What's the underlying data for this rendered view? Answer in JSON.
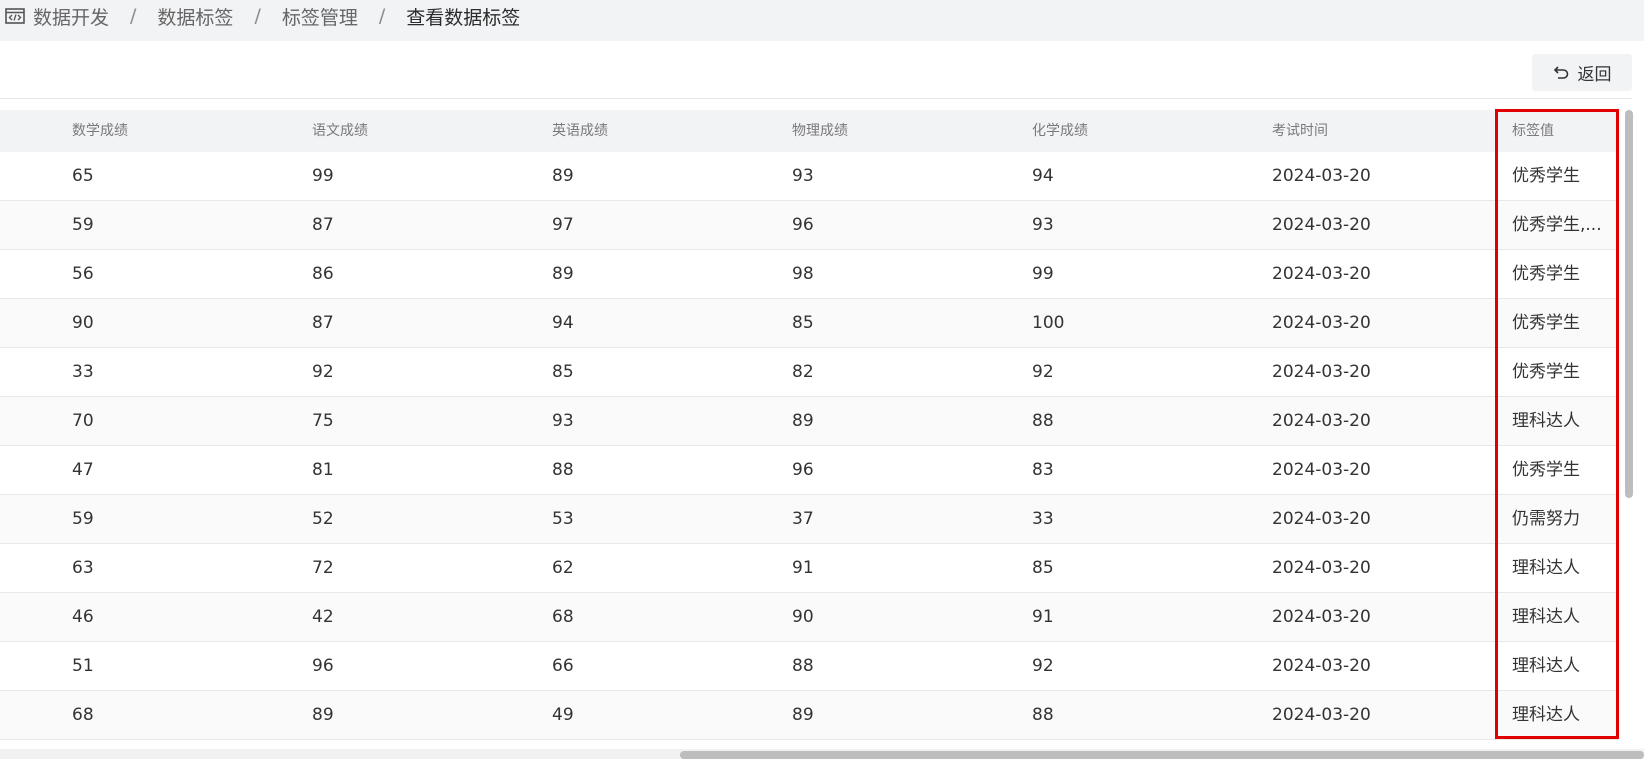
{
  "breadcrumb": {
    "icon": "code-window-icon",
    "items": [
      "数据开发",
      "数据标签",
      "标签管理",
      "查看数据标签"
    ],
    "separator": "/"
  },
  "toolbar": {
    "back_label": "返回",
    "back_icon": "undo-arrow-icon"
  },
  "table": {
    "columns": [
      "数学成绩",
      "语文成绩",
      "英语成绩",
      "物理成绩",
      "化学成绩",
      "考试时间",
      "标签值"
    ],
    "rows": [
      [
        "65",
        "99",
        "89",
        "93",
        "94",
        "2024-03-20",
        "优秀学生"
      ],
      [
        "59",
        "87",
        "97",
        "96",
        "93",
        "2024-03-20",
        "优秀学生,..."
      ],
      [
        "56",
        "86",
        "89",
        "98",
        "99",
        "2024-03-20",
        "优秀学生"
      ],
      [
        "90",
        "87",
        "94",
        "85",
        "100",
        "2024-03-20",
        "优秀学生"
      ],
      [
        "33",
        "92",
        "85",
        "82",
        "92",
        "2024-03-20",
        "优秀学生"
      ],
      [
        "70",
        "75",
        "93",
        "89",
        "88",
        "2024-03-20",
        "理科达人"
      ],
      [
        "47",
        "81",
        "88",
        "96",
        "83",
        "2024-03-20",
        "优秀学生"
      ],
      [
        "59",
        "52",
        "53",
        "37",
        "33",
        "2024-03-20",
        "仍需努力"
      ],
      [
        "63",
        "72",
        "62",
        "91",
        "85",
        "2024-03-20",
        "理科达人"
      ],
      [
        "46",
        "42",
        "68",
        "90",
        "91",
        "2024-03-20",
        "理科达人"
      ],
      [
        "51",
        "96",
        "66",
        "88",
        "92",
        "2024-03-20",
        "理科达人"
      ],
      [
        "68",
        "89",
        "49",
        "89",
        "88",
        "2024-03-20",
        "理科达人"
      ]
    ]
  },
  "colors": {
    "highlight_border": "#e00000",
    "header_bg": "#f2f3f5",
    "stripe_bg": "#fafafa"
  }
}
